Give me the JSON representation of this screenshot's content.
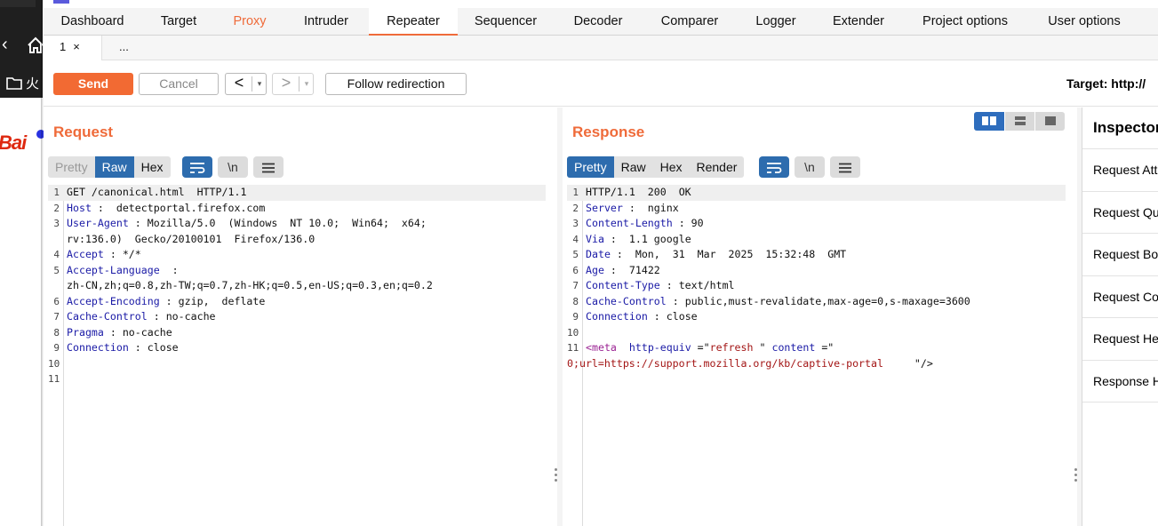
{
  "background_browser": {
    "bookmark_text": "火",
    "logo_text": "Bai"
  },
  "menu": {
    "tabs": [
      {
        "label": "Dashboard"
      },
      {
        "label": "Target"
      },
      {
        "label": "Proxy"
      },
      {
        "label": "Intruder"
      },
      {
        "label": "Repeater"
      },
      {
        "label": "Sequencer"
      },
      {
        "label": "Decoder"
      },
      {
        "label": "Comparer"
      },
      {
        "label": "Logger"
      },
      {
        "label": "Extender"
      },
      {
        "label": "Project options"
      },
      {
        "label": "User options"
      }
    ],
    "active": "Repeater"
  },
  "subtabs": {
    "active_label": "1",
    "close_glyph": "×",
    "more_label": "..."
  },
  "toolbar": {
    "send_label": "Send",
    "cancel_label": "Cancel",
    "prev_glyph": "<",
    "next_glyph": ">",
    "dropdown_glyph": "▾",
    "follow_label": "Follow redirection",
    "target_label": "Target: http://"
  },
  "request": {
    "title": "Request",
    "formats": [
      "Pretty",
      "Raw",
      "Hex"
    ],
    "selected_format": "Raw",
    "lines": [
      {
        "n": "1",
        "text": "GET /canonical.html  HTTP/1.1"
      },
      {
        "n": "2",
        "key": "Host",
        "value": " :  detectportal.firefox.com"
      },
      {
        "n": "3",
        "key": "User-Agent",
        "value": " : Mozilla/5.0  (Windows  NT 10.0;  Win64;  x64;"
      },
      {
        "n": "",
        "text": "rv:136.0)  Gecko/20100101  Firefox/136.0"
      },
      {
        "n": "4",
        "key": "Accept",
        "value": " : */*"
      },
      {
        "n": "5",
        "key": "Accept-Language",
        "value": "  :"
      },
      {
        "n": "",
        "text": "zh-CN,zh;q=0.8,zh-TW;q=0.7,zh-HK;q=0.5,en-US;q=0.3,en;q=0.2"
      },
      {
        "n": "6",
        "key": "Accept-Encoding",
        "value": " : gzip,  deflate"
      },
      {
        "n": "7",
        "key": "Cache-Control",
        "value": " : no-cache"
      },
      {
        "n": "8",
        "key": "Pragma",
        "value": " : no-cache"
      },
      {
        "n": "9",
        "key": "Connection",
        "value": " : close"
      },
      {
        "n": "10",
        "text": ""
      },
      {
        "n": "11",
        "text": ""
      }
    ]
  },
  "response": {
    "title": "Response",
    "formats": [
      "Pretty",
      "Raw",
      "Hex",
      "Render"
    ],
    "selected_format": "Pretty",
    "lines": [
      {
        "n": "1",
        "text": "HTTP/1.1  200  OK"
      },
      {
        "n": "2",
        "key": "Server",
        "value": " :  nginx"
      },
      {
        "n": "3",
        "key": "Content-Length",
        "value": " : 90"
      },
      {
        "n": "4",
        "key": "Via",
        "value": " :  1.1 google"
      },
      {
        "n": "5",
        "key": "Date",
        "value": " :  Mon,  31  Mar  2025  15:32:48  GMT"
      },
      {
        "n": "6",
        "key": "Age",
        "value": " :  71422"
      },
      {
        "n": "7",
        "key": "Content-Type",
        "value": " : text/html"
      },
      {
        "n": "8",
        "key": "Cache-Control",
        "value": " : public,must-revalidate,max-age=0,s-maxage=3600"
      },
      {
        "n": "9",
        "key": "Connection",
        "value": " : close"
      },
      {
        "n": "10",
        "text": ""
      }
    ],
    "html_line": {
      "n": "11",
      "tag_open": "<meta",
      "attr1": "http-equiv",
      "eq1": " =\"",
      "val1": "refresh",
      "q1": " \"",
      "attr2": "content",
      "eq2": " =\""
    },
    "html_line_cont": {
      "val2": "0;url=https://support.mozilla.org/kb/captive-portal",
      "close": "\"/>"
    }
  },
  "inspector": {
    "title": "Inspector",
    "items": [
      "Request Attributes",
      "Request Query Parameters",
      "Request Body Parameters",
      "Request Cookies",
      "Request Headers",
      "Response Headers"
    ]
  },
  "colors": {
    "accent": "#ef6b3a",
    "selected_blue": "#2d6cae",
    "header_key": "#1a1aa6"
  }
}
